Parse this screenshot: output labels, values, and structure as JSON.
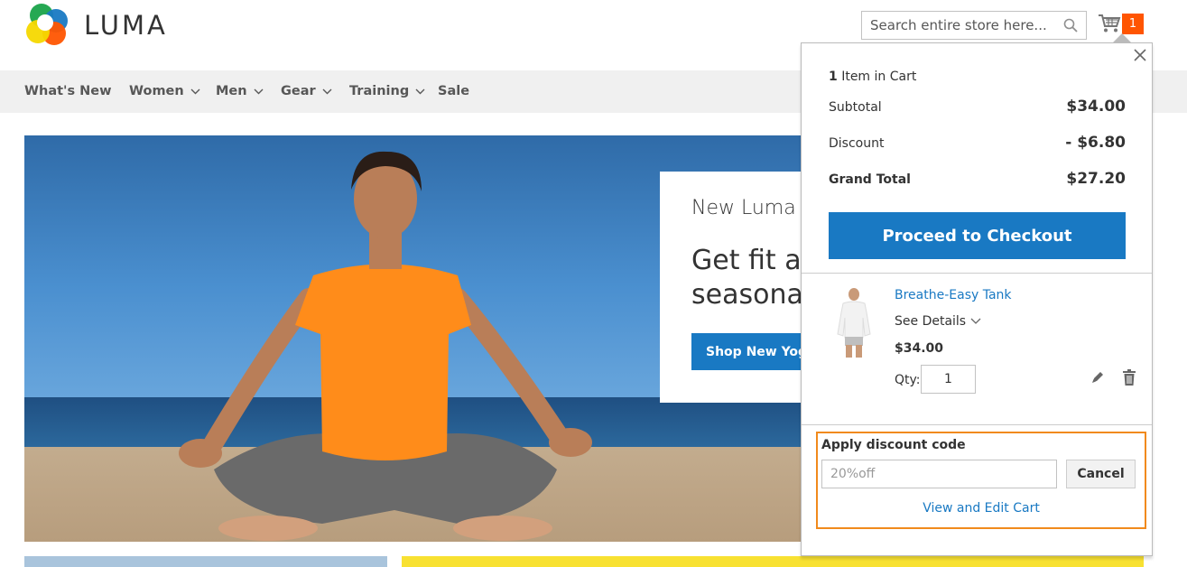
{
  "header": {
    "logo_text": "LUMA",
    "search_placeholder": "Search entire store here...",
    "cart_count": "1"
  },
  "nav": {
    "items": [
      {
        "label": "What's New",
        "has_dropdown": false
      },
      {
        "label": "Women",
        "has_dropdown": true
      },
      {
        "label": "Men",
        "has_dropdown": true
      },
      {
        "label": "Gear",
        "has_dropdown": true
      },
      {
        "label": "Training",
        "has_dropdown": true
      },
      {
        "label": "Sale",
        "has_dropdown": false
      }
    ]
  },
  "hero": {
    "subtitle": "New Luma Yoga Collection",
    "title_line1": "Get fit and look fab in new",
    "title_line2": "seasonal styles",
    "button_label": "Shop New Yoga"
  },
  "minicart": {
    "items_count": "1",
    "items_label": "Item in Cart",
    "subtotal_label": "Subtotal",
    "subtotal_value": "$34.00",
    "discount_label": "Discount",
    "discount_value": "- $6.80",
    "grand_total_label": "Grand Total",
    "grand_total_value": "$27.20",
    "checkout_label": "Proceed to Checkout",
    "product": {
      "name": "Breathe-Easy Tank",
      "see_details": "See Details",
      "price": "$34.00",
      "qty_label": "Qty:",
      "qty_value": "1"
    },
    "discount": {
      "label": "Apply discount code",
      "code": "20%off",
      "cancel_label": "Cancel",
      "view_cart_label": "View and Edit Cart"
    }
  },
  "colors": {
    "accent_blue": "#1979c3",
    "cart_badge": "#ff5501",
    "highlight_border": "#f18a1c",
    "nav_bg": "#f0f0f0"
  }
}
